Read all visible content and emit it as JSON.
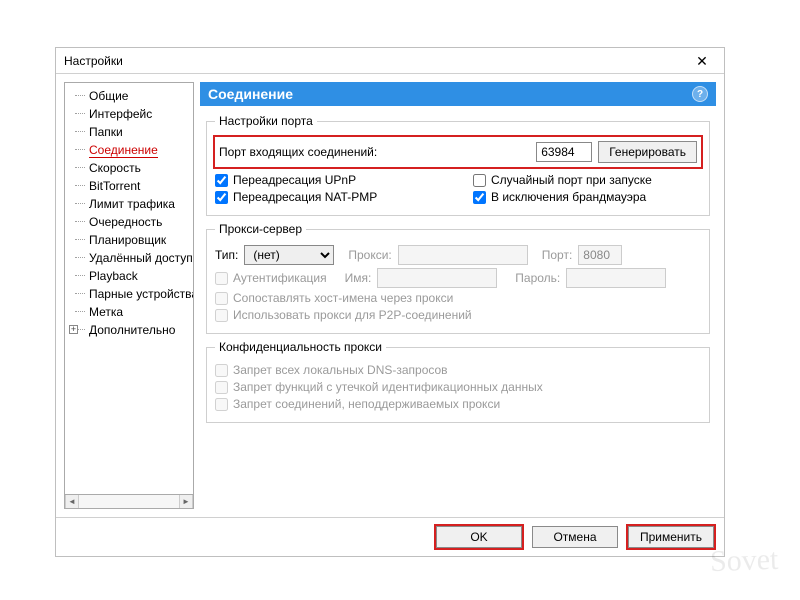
{
  "window": {
    "title": "Настройки"
  },
  "tree": {
    "items": [
      {
        "label": "Общие"
      },
      {
        "label": "Интерфейс"
      },
      {
        "label": "Папки"
      },
      {
        "label": "Соединение",
        "selected": true
      },
      {
        "label": "Скорость"
      },
      {
        "label": "BitTorrent"
      },
      {
        "label": "Лимит трафика"
      },
      {
        "label": "Очередность"
      },
      {
        "label": "Планировщик"
      },
      {
        "label": "Удалённый доступ"
      },
      {
        "label": "Playback"
      },
      {
        "label": "Парные устройства"
      },
      {
        "label": "Метка"
      },
      {
        "label": "Дополнительно",
        "expandable": true
      }
    ]
  },
  "section": {
    "title": "Соединение"
  },
  "port_settings": {
    "legend": "Настройки порта",
    "port_label": "Порт входящих соединений:",
    "port_value": "63984",
    "generate_label": "Генерировать",
    "upnp_label": "Переадресация UPnP",
    "upnp_checked": true,
    "natpmp_label": "Переадресация NAT-PMP",
    "natpmp_checked": true,
    "random_port_label": "Случайный порт при запуске",
    "random_port_checked": false,
    "firewall_label": "В исключения брандмауэра",
    "firewall_checked": true
  },
  "proxy": {
    "legend": "Прокси-сервер",
    "type_label": "Тип:",
    "type_value": "(нет)",
    "proxy_label": "Прокси:",
    "proxy_value": "",
    "port_label": "Порт:",
    "port_value": "8080",
    "auth_label": "Аутентификация",
    "auth_checked": false,
    "user_label": "Имя:",
    "user_value": "",
    "pass_label": "Пароль:",
    "pass_value": "",
    "resolve_label": "Сопоставлять хост-имена через прокси",
    "resolve_checked": false,
    "p2p_label": "Использовать прокси для P2P-соединений",
    "p2p_checked": false
  },
  "privacy": {
    "legend": "Конфиденциальность прокси",
    "dns_label": "Запрет всех локальных DNS-запросов",
    "dns_checked": false,
    "leak_label": "Запрет функций с утечкой идентификационных данных",
    "leak_checked": false,
    "unsupported_label": "Запрет соединений, неподдерживаемых прокси",
    "unsupported_checked": false
  },
  "footer": {
    "ok_label": "OK",
    "cancel_label": "Отмена",
    "apply_label": "Применить"
  },
  "watermark": "Sovet"
}
